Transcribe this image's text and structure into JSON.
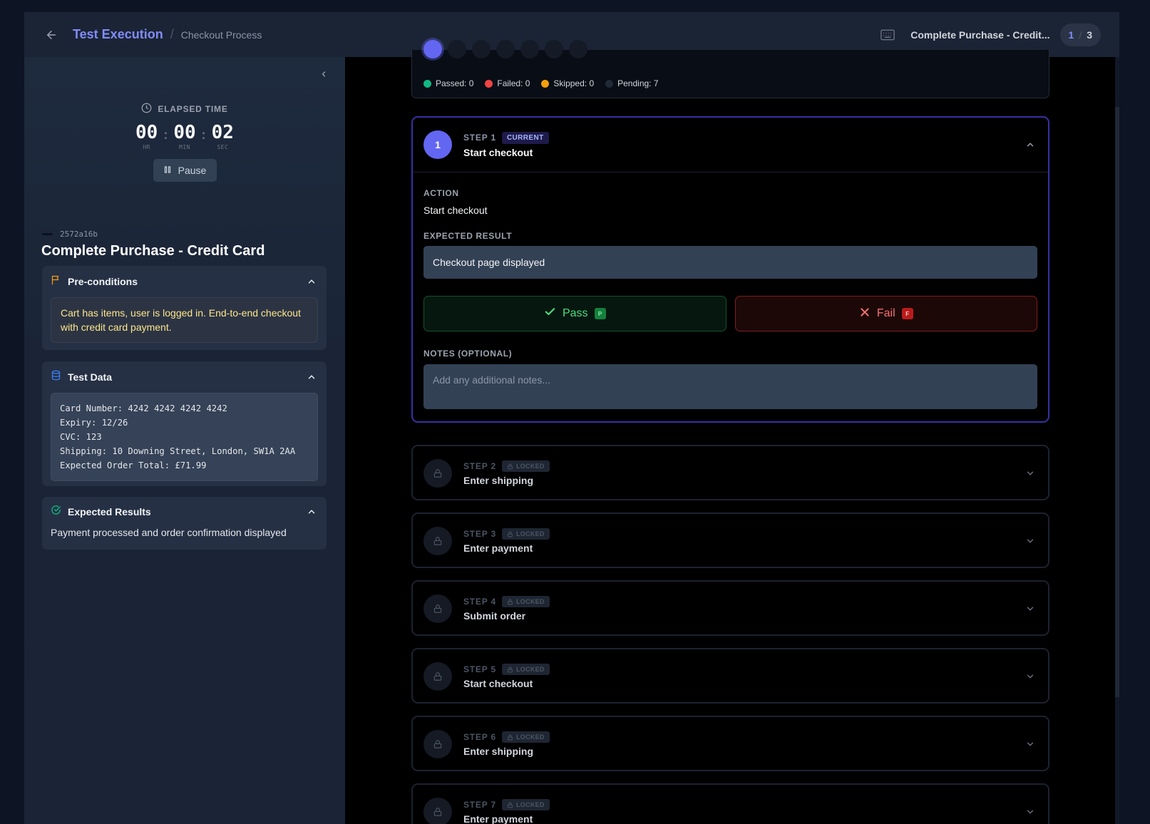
{
  "header": {
    "title": "Test Execution",
    "separator": "/",
    "subtitle": "Checkout Process",
    "case_title": "Complete Purchase - Credit...",
    "counter_current": "1",
    "counter_sep": "/",
    "counter_total": "3"
  },
  "timer": {
    "label": "ELAPSED TIME",
    "hours": "00",
    "minutes": "00",
    "seconds": "02",
    "hr_unit": "HR",
    "min_unit": "MIN",
    "sec_unit": "SEC",
    "pause_label": "Pause"
  },
  "test_case": {
    "id": "2572a16b",
    "title": "Complete Purchase - Credit Card"
  },
  "preconditions": {
    "title": "Pre-conditions",
    "text": "Cart has items, user is logged in. End-to-end checkout with credit card payment."
  },
  "test_data": {
    "title": "Test Data",
    "text": "Card Number: 4242 4242 4242 4242\nExpiry: 12/26\nCVC: 123\nShipping: 10 Downing Street, London, SW1A 2AA\nExpected Order Total: £71.99"
  },
  "expected_results": {
    "title": "Expected Results",
    "text": "Payment processed and order confirmation displayed"
  },
  "summary": {
    "passed": "Passed: 0",
    "failed": "Failed: 0",
    "skipped": "Skipped: 0",
    "pending": "Pending: 7",
    "colors": {
      "passed": "#10b981",
      "failed": "#ef4444",
      "skipped": "#f59e0b",
      "pending": "#1f2937"
    }
  },
  "current_step": {
    "number": "1",
    "step_label": "STEP 1",
    "current_tag": "CURRENT",
    "name": "Start checkout",
    "action_label": "ACTION",
    "action": "Start checkout",
    "expected_label": "EXPECTED RESULT",
    "expected": "Checkout page displayed",
    "pass_label": "Pass",
    "pass_key": "P",
    "fail_label": "Fail",
    "fail_key": "F",
    "notes_label": "NOTES (OPTIONAL)",
    "notes_placeholder": "Add any additional notes..."
  },
  "locked_tag": "LOCKED",
  "steps": [
    {
      "label": "STEP 2",
      "name": "Enter shipping"
    },
    {
      "label": "STEP 3",
      "name": "Enter payment"
    },
    {
      "label": "STEP 4",
      "name": "Submit order"
    },
    {
      "label": "STEP 5",
      "name": "Start checkout"
    },
    {
      "label": "STEP 6",
      "name": "Enter shipping"
    },
    {
      "label": "STEP 7",
      "name": "Enter payment"
    }
  ],
  "colors": {
    "accent": "#6366f1",
    "accent_text": "#818cf8"
  }
}
